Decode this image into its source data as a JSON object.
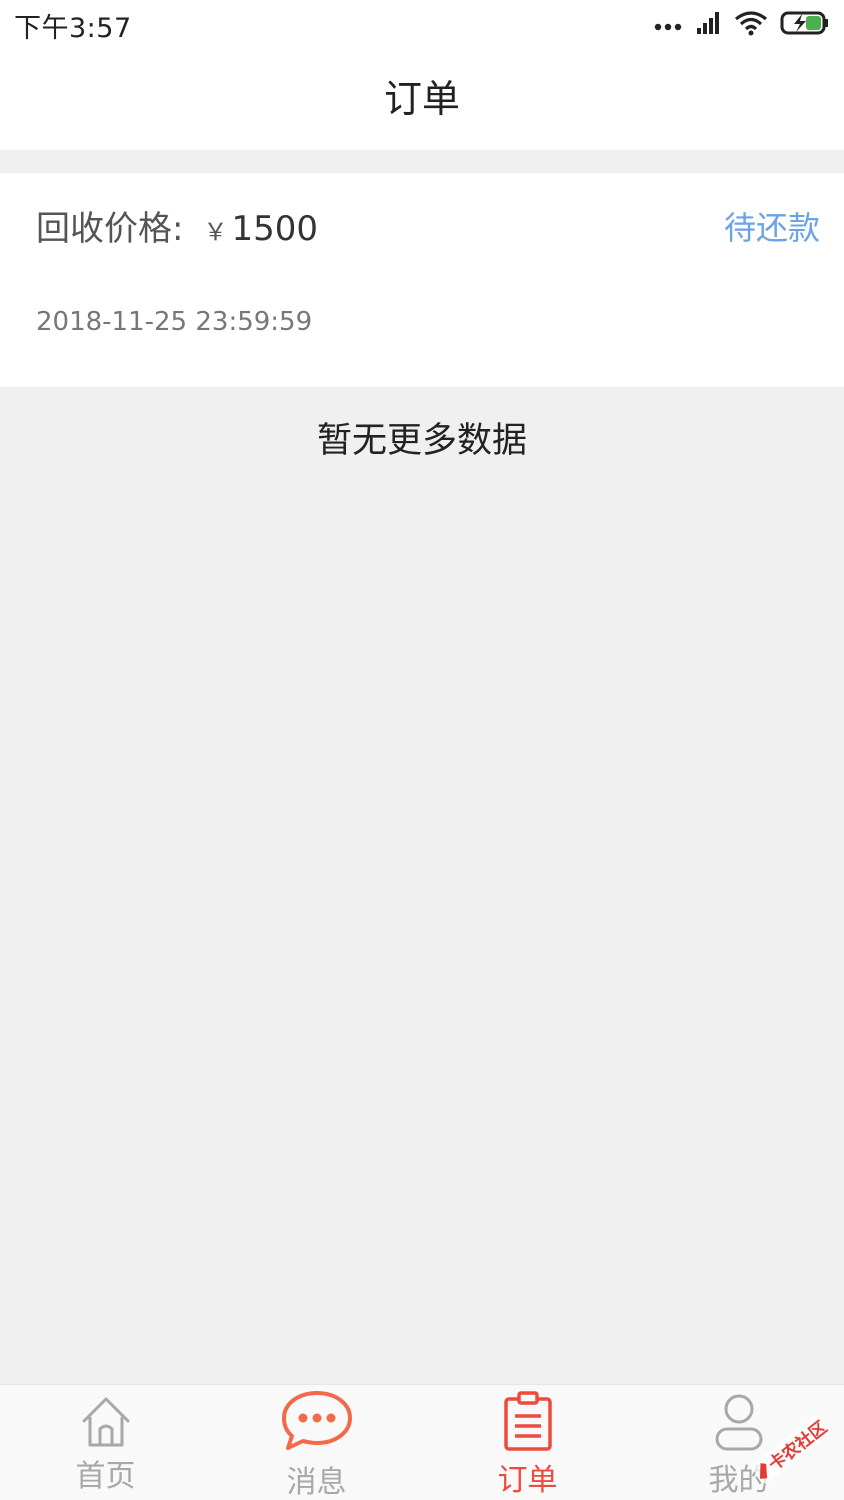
{
  "status_bar": {
    "time": "下午3:57",
    "icons": [
      "more-dots-icon",
      "signal-icon",
      "wifi-icon",
      "battery-charging-icon"
    ]
  },
  "header": {
    "title": "订单"
  },
  "order": {
    "price_label": "回收价格:",
    "currency_symbol": "￥",
    "price_value": "1500",
    "status": "待还款",
    "date": "2018-11-25 23:59:59"
  },
  "list_footer": {
    "no_more_text": "暂无更多数据"
  },
  "tab_bar": {
    "tabs": [
      {
        "label": "首页",
        "icon": "home-icon",
        "active": false
      },
      {
        "label": "消息",
        "icon": "message-bubble-icon",
        "active": false
      },
      {
        "label": "订单",
        "icon": "order-clipboard-icon",
        "active": true
      },
      {
        "label": "我的",
        "icon": "user-icon",
        "active": false
      }
    ]
  },
  "watermark": {
    "text": "卡农社区"
  },
  "colors": {
    "accent_red": "#ee4b3e",
    "message_orange": "#f26a4a",
    "status_blue": "#6aa3e8",
    "inactive_gray": "#a8a8a8"
  }
}
